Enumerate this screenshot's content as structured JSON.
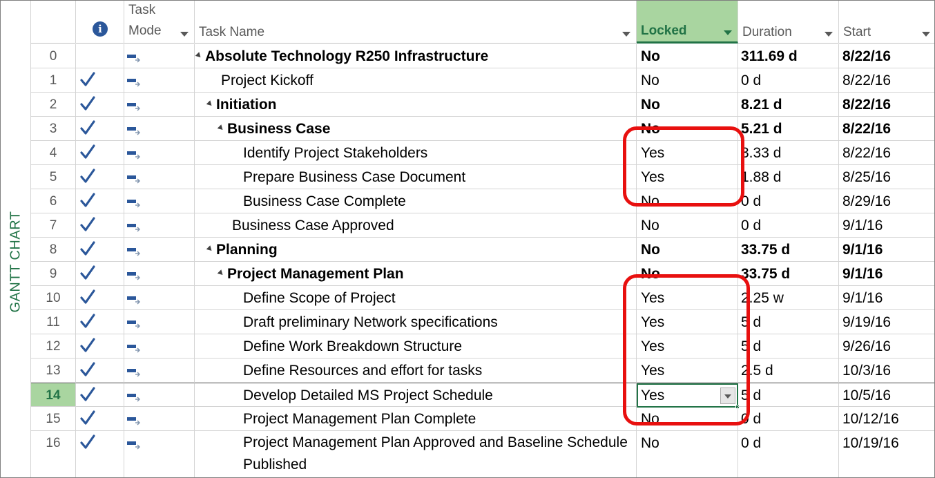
{
  "view_bar": {
    "label": "GANTT CHART"
  },
  "columns": {
    "info_icon": "info-icon",
    "task_mode": "Task Mode",
    "task_name": "Task Name",
    "locked": "Locked",
    "duration": "Duration",
    "start": "Start"
  },
  "rows": [
    {
      "id": "0",
      "check": false,
      "name": "Absolute Technology R250 Infrastructure",
      "level": 0,
      "summary": true,
      "bold": true,
      "locked": "No",
      "duration": "311.69 d",
      "start": "8/22/16"
    },
    {
      "id": "1",
      "check": true,
      "name": "Project Kickoff",
      "level": 1,
      "summary": false,
      "bold": false,
      "locked": "No",
      "duration": "0 d",
      "start": "8/22/16"
    },
    {
      "id": "2",
      "check": true,
      "name": "Initiation",
      "level": 1,
      "summary": true,
      "bold": true,
      "locked": "No",
      "duration": "8.21 d",
      "start": "8/22/16"
    },
    {
      "id": "3",
      "check": true,
      "name": "Business Case",
      "level": 2,
      "summary": true,
      "bold": true,
      "locked": "No",
      "duration": "5.21 d",
      "start": "8/22/16"
    },
    {
      "id": "4",
      "check": true,
      "name": "Identify Project Stakeholders",
      "level": 3,
      "summary": false,
      "bold": false,
      "locked": "Yes",
      "duration": "3.33 d",
      "start": "8/22/16"
    },
    {
      "id": "5",
      "check": true,
      "name": "Prepare Business Case Document",
      "level": 3,
      "summary": false,
      "bold": false,
      "locked": "Yes",
      "duration": "1.88 d",
      "start": "8/25/16"
    },
    {
      "id": "6",
      "check": true,
      "name": "Business Case Complete",
      "level": 3,
      "summary": false,
      "bold": false,
      "locked": "No",
      "duration": "0 d",
      "start": "8/29/16"
    },
    {
      "id": "7",
      "check": true,
      "name": "Business Case Approved",
      "level": 2,
      "summary": false,
      "bold": false,
      "locked": "No",
      "duration": "0 d",
      "start": "9/1/16"
    },
    {
      "id": "8",
      "check": true,
      "name": "Planning",
      "level": 1,
      "summary": true,
      "bold": true,
      "locked": "No",
      "duration": "33.75 d",
      "start": "9/1/16"
    },
    {
      "id": "9",
      "check": true,
      "name": "Project Management Plan",
      "level": 2,
      "summary": true,
      "bold": true,
      "locked": "No",
      "duration": "33.75 d",
      "start": "9/1/16"
    },
    {
      "id": "10",
      "check": true,
      "name": "Define Scope of Project",
      "level": 3,
      "summary": false,
      "bold": false,
      "locked": "Yes",
      "duration": "2.25 w",
      "start": "9/1/16"
    },
    {
      "id": "11",
      "check": true,
      "name": "Draft preliminary Network specifications",
      "level": 3,
      "summary": false,
      "bold": false,
      "locked": "Yes",
      "duration": "5 d",
      "start": "9/19/16"
    },
    {
      "id": "12",
      "check": true,
      "name": "Define Work Breakdown Structure",
      "level": 3,
      "summary": false,
      "bold": false,
      "locked": "Yes",
      "duration": "5 d",
      "start": "9/26/16"
    },
    {
      "id": "13",
      "check": true,
      "name": "Define Resources and effort for tasks",
      "level": 3,
      "summary": false,
      "bold": false,
      "locked": "Yes",
      "duration": "2.5 d",
      "start": "10/3/16"
    },
    {
      "id": "14",
      "check": true,
      "name": "Develop Detailed MS Project Schedule",
      "level": 3,
      "summary": false,
      "bold": false,
      "locked": "Yes",
      "duration": "5 d",
      "start": "10/5/16",
      "selected": true
    },
    {
      "id": "15",
      "check": true,
      "name": "Project Management Plan Complete",
      "level": 3,
      "summary": false,
      "bold": false,
      "locked": "No",
      "duration": "0 d",
      "start": "10/12/16"
    },
    {
      "id": "16",
      "check": true,
      "name": "Project Management Plan Approved and Baseline Schedule Published",
      "level": 3,
      "summary": false,
      "bold": false,
      "locked": "No",
      "duration": "0 d",
      "start": "10/19/16"
    }
  ],
  "colors": {
    "accent_green": "#217346",
    "header_green_fill": "#a9d5a0",
    "callout_red": "#e8100f",
    "check_blue": "#2b579a"
  }
}
